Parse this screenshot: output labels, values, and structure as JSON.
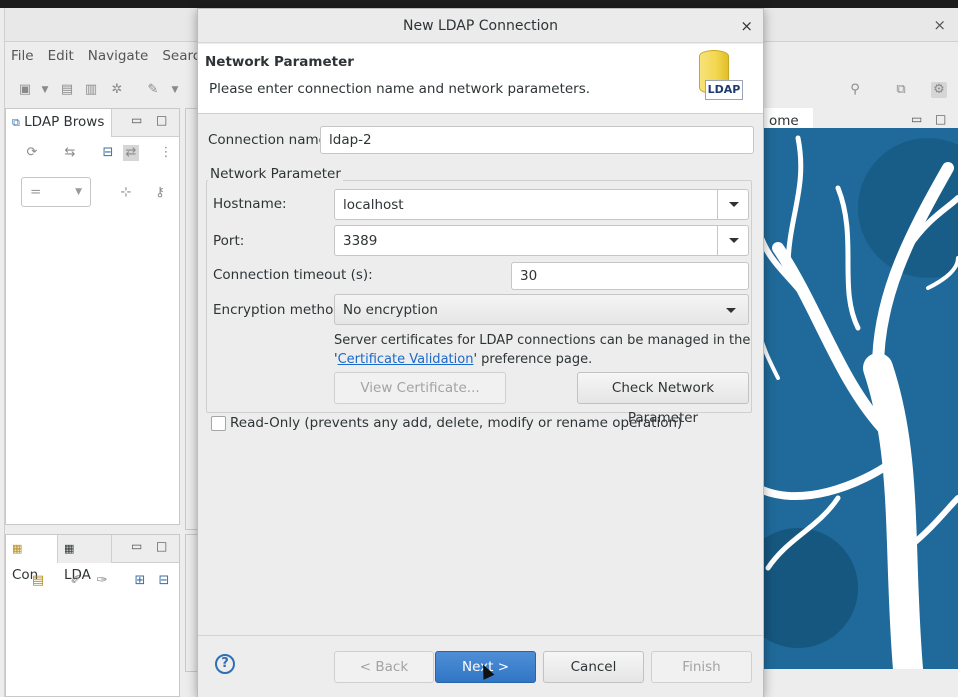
{
  "ide": {
    "menu": [
      "File",
      "Edit",
      "Navigate",
      "Search"
    ],
    "views": {
      "ldap_browser_tab": "LDAP Brows",
      "connections_tab": "Con",
      "ldap_tab": "LDA",
      "welcome_tab": "ome"
    },
    "filter_value": "="
  },
  "dialog": {
    "title": "New LDAP Connection",
    "close_glyph": "×",
    "banner_title": "Network Parameter",
    "banner_message": "Please enter connection name and network parameters.",
    "banner_icon_label": "LDAP",
    "connection_name_label": "Connection name:",
    "connection_name_value": "ldap-2",
    "group_label": "Network Parameter",
    "hostname_label": "Hostname:",
    "hostname_value": "localhost",
    "port_label": "Port:",
    "port_value": "3389",
    "timeout_label": "Connection timeout (s):",
    "timeout_value": "30",
    "encryption_label": "Encryption method:",
    "encryption_value": "No encryption",
    "note_line1": "Server certificates for LDAP connections can be managed in the",
    "note_quote_open": "'",
    "note_link": "Certificate Validation",
    "note_line2_suffix": "' preference page.",
    "view_certificate_label": "View Certificate...",
    "check_network_label": "Check Network Parameter",
    "readonly_label": "Read-Only (prevents any add, delete, modify or rename operation)",
    "readonly_checked": false,
    "help_glyph": "?",
    "back_label": "< Back",
    "next_label": "Next >",
    "cancel_label": "Cancel",
    "finish_label": "Finish"
  }
}
